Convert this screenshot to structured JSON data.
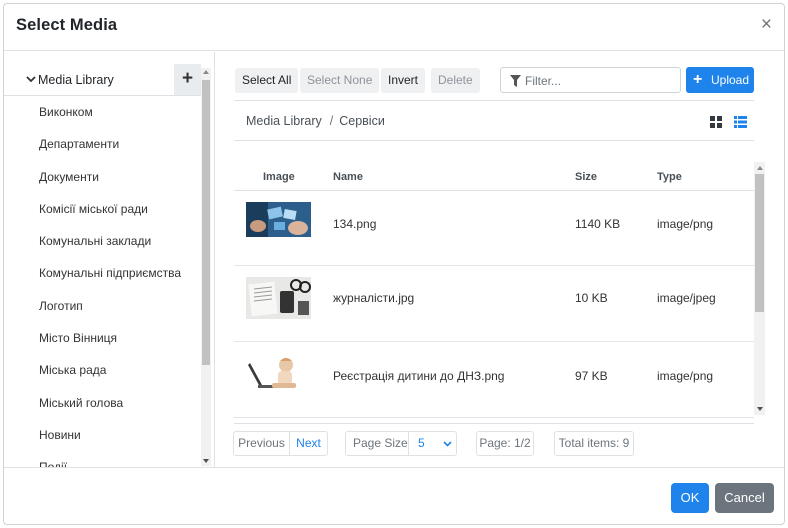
{
  "dialog": {
    "title": "Select Media",
    "close_glyph": "×"
  },
  "sidebar": {
    "root_label": "Media Library",
    "add_glyph": "+",
    "items": [
      {
        "label": "Виконком"
      },
      {
        "label": "Департаменти"
      },
      {
        "label": "Документи"
      },
      {
        "label": "Комісії міської ради"
      },
      {
        "label": "Комунальні заклади"
      },
      {
        "label": "Комунальні підприємства"
      },
      {
        "label": "Логотип"
      },
      {
        "label": "Місто Вінниця"
      },
      {
        "label": "Міська рада"
      },
      {
        "label": "Міський голова"
      },
      {
        "label": "Новини"
      },
      {
        "label": "Події"
      }
    ]
  },
  "toolbar": {
    "select_all": "Select All",
    "select_none": "Select None",
    "invert": "Invert",
    "delete": "Delete",
    "filter_placeholder": "Filter...",
    "upload_glyph": "+",
    "upload": "Upload"
  },
  "breadcrumb": {
    "root": "Media Library",
    "separator": "/",
    "current": "Сервіси"
  },
  "view_toggle": {
    "grid_icon": "grid-view-icon",
    "list_icon": "list-view-icon",
    "active": "list"
  },
  "table": {
    "headers": {
      "image": "Image",
      "name": "Name",
      "size": "Size",
      "type": "Type"
    },
    "rows": [
      {
        "name": "134.png",
        "size": "1140 KB",
        "type": "image/png"
      },
      {
        "name": "журналісти.jpg",
        "size": "10 KB",
        "type": "image/jpeg"
      },
      {
        "name": "Реєстрація дитини до ДНЗ.png",
        "size": "97 KB",
        "type": "image/png"
      }
    ]
  },
  "pager": {
    "previous": "Previous",
    "next": "Next",
    "page_size_label": "Page Size",
    "page_size_value": "5",
    "page": "Page: 1/2",
    "total": "Total items: 9"
  },
  "footer": {
    "ok": "OK",
    "cancel": "Cancel"
  },
  "colors": {
    "primary": "#1e83ea",
    "secondary": "#6c757d",
    "border": "#dee2e6"
  }
}
